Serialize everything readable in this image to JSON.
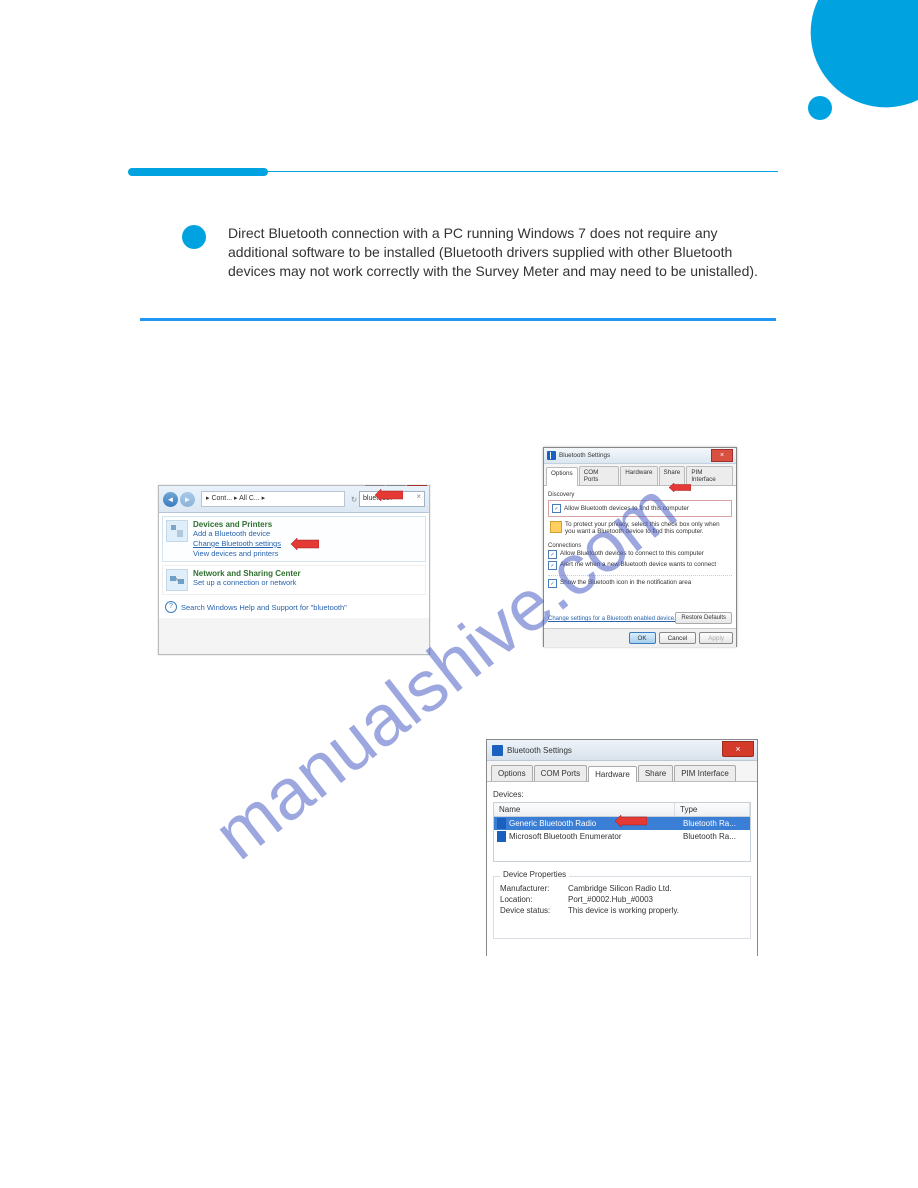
{
  "corner_decoration": "corner-blob",
  "bullet_text": "Direct Bluetooth connection with a PC running Windows 7 does not require any additional software to be installed (Bluetooth drivers supplied with other Bluetooth devices may not work correctly with the Survey Meter and may need to be unistalled).",
  "shot1": {
    "breadcrumb": "▸ Cont... ▸ All C...   ▸",
    "search_value": "bluetooth",
    "window_min": "_",
    "window_max": "☐",
    "window_close": "×",
    "close_x": "×",
    "res1_header": "Devices and Printers",
    "res1_link1": "Add a Bluetooth device",
    "res1_link2": "Change Bluetooth settings",
    "res1_link3": "View devices and printers",
    "res2_header": "Network and Sharing Center",
    "res2_link1": "Set up a connection or network",
    "footer": "Search Windows Help and Support for \"bluetooth\""
  },
  "shot2": {
    "title": "Bluetooth Settings",
    "close": "×",
    "tab_options": "Options",
    "tab_com": "COM Ports",
    "tab_hw": "Hardware",
    "tab_share": "Share",
    "tab_pim": "PIM Interface",
    "discovery_label": "Discovery",
    "discovery_chk": "Allow Bluetooth devices to find this computer",
    "warn": "To protect your privacy, select this check box only when you want a Bluetooth device to find this computer.",
    "connections_label": "Connections",
    "conn1": "Allow Bluetooth devices to connect to this computer",
    "conn2": "Alert me when a new Bluetooth device wants to connect",
    "show_icon": "Show the Bluetooth icon in the notification area",
    "help_link": "Change settings for a Bluetooth enabled device.",
    "restore": "Restore Defaults",
    "ok": "OK",
    "cancel": "Cancel",
    "apply": "Apply"
  },
  "shot3": {
    "title": "Bluetooth Settings",
    "close": "×",
    "tab_options": "Options",
    "tab_com": "COM Ports",
    "tab_hw": "Hardware",
    "tab_share": "Share",
    "tab_pim": "PIM Interface",
    "devices_label": "Devices:",
    "col_name": "Name",
    "col_type": "Type",
    "row1_name": "Generic Bluetooth Radio",
    "row1_type": "Bluetooth Ra...",
    "row2_name": "Microsoft Bluetooth Enumerator",
    "row2_type": "Bluetooth Ra...",
    "props_label": "Device Properties",
    "manu_k": "Manufacturer:",
    "manu_v": "Cambridge Silicon Radio Ltd.",
    "loc_k": "Location:",
    "loc_v": "Port_#0002.Hub_#0003",
    "stat_k": "Device status:",
    "stat_v": "This device is working properly."
  },
  "watermark": "manualshive.com"
}
